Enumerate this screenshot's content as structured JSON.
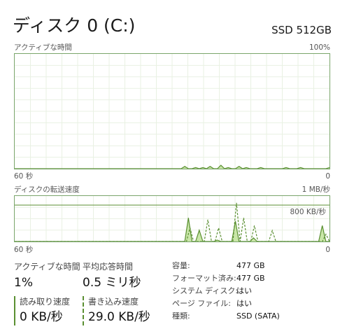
{
  "header": {
    "title": "ディスク 0 (C:)",
    "model": "SSD 512GB"
  },
  "active_time_graph": {
    "label": "アクティブな時間",
    "max_label": "100%",
    "time_left": "60 秒",
    "time_right": "0",
    "samples": [
      0,
      0,
      0,
      0,
      0,
      0,
      0,
      0,
      0,
      0,
      0,
      0,
      0,
      0,
      0,
      0,
      0,
      0,
      0,
      0,
      0,
      0,
      0,
      0,
      0,
      0,
      0,
      0,
      0,
      0,
      0,
      0,
      0,
      0,
      0,
      0,
      0,
      0,
      0,
      0,
      0,
      0,
      0,
      0,
      0,
      0,
      0,
      2,
      0,
      0,
      1,
      0,
      1,
      0,
      2,
      0,
      0,
      3,
      0,
      1,
      0,
      0,
      2,
      0,
      1,
      0,
      0,
      0,
      1,
      0,
      0,
      0,
      0,
      0,
      0,
      1,
      0,
      0,
      0,
      1,
      0,
      0,
      0,
      0,
      0,
      0,
      0,
      1
    ],
    "line_color": "#5a8f31",
    "fill_color": "#c9e6a8"
  },
  "transfer_graph": {
    "label": "ディスクの転送速度",
    "max_label": "1 MB/秒",
    "ref_label": "800 KB/秒",
    "ref_value_kb": 800,
    "max_value_kb": 1000,
    "time_left": "60 秒",
    "time_right": "0",
    "read_kb": [
      0,
      0,
      0,
      0,
      0,
      0,
      0,
      0,
      0,
      0,
      0,
      0,
      0,
      0,
      0,
      0,
      0,
      0,
      0,
      0,
      0,
      0,
      0,
      0,
      0,
      0,
      0,
      0,
      0,
      0,
      0,
      0,
      0,
      0,
      0,
      0,
      0,
      0,
      0,
      0,
      0,
      0,
      0,
      0,
      0,
      0,
      0,
      0,
      520,
      0,
      0,
      250,
      0,
      0,
      0,
      0,
      30,
      0,
      0,
      0,
      0,
      450,
      0,
      0,
      0,
      0,
      80,
      0,
      0,
      0,
      0,
      0,
      0,
      0,
      0,
      0,
      0,
      0,
      0,
      0,
      0,
      0,
      0,
      0,
      0,
      350,
      0,
      0
    ],
    "write_kb": [
      0,
      0,
      0,
      0,
      0,
      0,
      0,
      0,
      0,
      0,
      0,
      0,
      0,
      0,
      0,
      0,
      0,
      0,
      0,
      0,
      0,
      0,
      0,
      0,
      0,
      0,
      0,
      0,
      0,
      0,
      0,
      0,
      0,
      0,
      0,
      0,
      0,
      0,
      0,
      0,
      0,
      0,
      0,
      0,
      0,
      0,
      0,
      0,
      0,
      300,
      0,
      0,
      0,
      0,
      480,
      0,
      0,
      300,
      0,
      0,
      0,
      0,
      850,
      0,
      520,
      0,
      0,
      350,
      0,
      0,
      0,
      0,
      240,
      0,
      0,
      0,
      0,
      0,
      0,
      0,
      0,
      0,
      0,
      0,
      0,
      0,
      0,
      160,
      0
    ]
  },
  "stats": {
    "active_time_label": "アクティブな時間",
    "active_time_value": "1%",
    "avg_response_label": "平均応答時間",
    "avg_response_value": "0.5 ミリ秒",
    "read_speed_label": "読み取り速度",
    "read_speed_value": "0 KB/秒",
    "write_speed_label": "書き込み速度",
    "write_speed_value": "29.0 KB/秒"
  },
  "properties": [
    {
      "label": "容量:",
      "value": "477 GB"
    },
    {
      "label": "フォーマット済み:",
      "value": "477 GB"
    },
    {
      "label": "システム ディスク:",
      "value": "はい"
    },
    {
      "label": "ページ ファイル:",
      "value": "はい"
    },
    {
      "label": "種類:",
      "value": "SSD (SATA)"
    }
  ]
}
